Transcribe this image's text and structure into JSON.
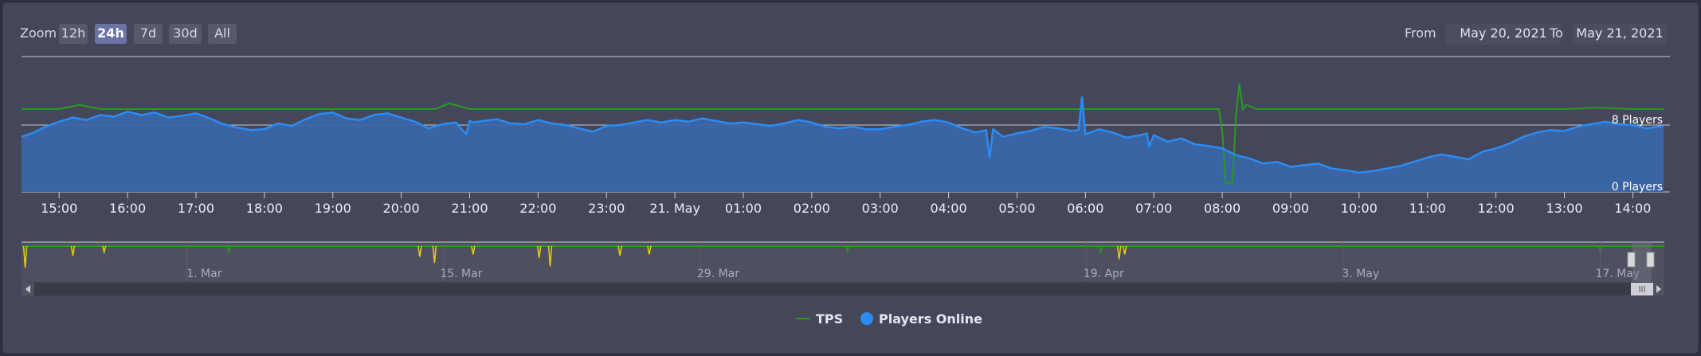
{
  "zoom": {
    "label": "Zoom",
    "buttons": [
      "12h",
      "24h",
      "7d",
      "30d",
      "All"
    ],
    "selected": "24h"
  },
  "range": {
    "from_label": "From",
    "from_value": "May 20, 2021",
    "to_label": "To",
    "to_value": "May 21, 2021"
  },
  "colors": {
    "tps": "#2a9a1f",
    "players": "#2a8cf5",
    "players_fill": "#3a66a8",
    "warn": "#e6cd16"
  },
  "chart_data": {
    "type": "area",
    "title": "",
    "x_ticks": [
      "15:00",
      "16:00",
      "17:00",
      "18:00",
      "19:00",
      "20:00",
      "21:00",
      "22:00",
      "23:00",
      "21. May",
      "01:00",
      "02:00",
      "03:00",
      "04:00",
      "05:00",
      "06:00",
      "07:00",
      "08:00",
      "09:00",
      "10:00",
      "11:00",
      "12:00",
      "13:00",
      "14:00"
    ],
    "xlim_hours": [
      14.45,
      38.45
    ],
    "y_axis": {
      "min": 0,
      "max": 8,
      "labels": [
        "0 Players",
        "8 Players"
      ]
    },
    "series": [
      {
        "name": "TPS",
        "type": "line",
        "x": [
          14.45,
          15.0,
          15.3,
          15.6,
          16.0,
          16.5,
          17.0,
          17.5,
          18.0,
          18.5,
          19.0,
          19.5,
          20.0,
          20.5,
          20.7,
          21.0,
          21.5,
          22.0,
          22.5,
          23.0,
          23.5,
          24.0,
          24.5,
          25.0,
          25.5,
          26.0,
          26.5,
          27.0,
          27.5,
          28.0,
          28.5,
          29.0,
          29.5,
          30.0,
          30.5,
          31.0,
          31.5,
          31.95,
          32.0,
          32.05,
          32.15,
          32.2,
          32.25,
          32.3,
          32.35,
          32.5,
          33.0,
          33.5,
          34.0,
          34.5,
          35.0,
          35.5,
          36.0,
          36.5,
          37.0,
          37.5,
          38.0,
          38.45
        ],
        "values": [
          20,
          20,
          20.3,
          20,
          20,
          20,
          20,
          20,
          20,
          20,
          20,
          20,
          20,
          20,
          20.4,
          20,
          20,
          20,
          20,
          20,
          20,
          20,
          20,
          20,
          20,
          20,
          20,
          20,
          20,
          20,
          20,
          20,
          20,
          20,
          20,
          20,
          20,
          20,
          18.5,
          14.8,
          14.9,
          19.5,
          21.8,
          20,
          20.3,
          20,
          20,
          20,
          20,
          20,
          20,
          20,
          20,
          20,
          20,
          20.1,
          20,
          20
        ]
      },
      {
        "name": "Players Online",
        "type": "area",
        "x": [
          14.45,
          14.6,
          14.8,
          15.0,
          15.2,
          15.4,
          15.6,
          15.8,
          16.0,
          16.2,
          16.4,
          16.6,
          16.8,
          17.0,
          17.2,
          17.4,
          17.6,
          17.8,
          18.0,
          18.2,
          18.4,
          18.6,
          18.8,
          19.0,
          19.2,
          19.4,
          19.6,
          19.8,
          20.0,
          20.2,
          20.4,
          20.6,
          20.8,
          20.95,
          21.0,
          21.05,
          21.2,
          21.4,
          21.6,
          21.8,
          22.0,
          22.2,
          22.4,
          22.6,
          22.8,
          23.0,
          23.2,
          23.4,
          23.6,
          23.8,
          24.0,
          24.2,
          24.4,
          24.6,
          24.8,
          25.0,
          25.2,
          25.4,
          25.6,
          25.8,
          26.0,
          26.2,
          26.4,
          26.6,
          26.8,
          27.0,
          27.2,
          27.4,
          27.6,
          27.8,
          28.0,
          28.2,
          28.4,
          28.55,
          28.6,
          28.65,
          28.8,
          29.0,
          29.2,
          29.4,
          29.6,
          29.8,
          29.9,
          29.95,
          30.0,
          30.2,
          30.4,
          30.6,
          30.8,
          30.9,
          30.93,
          31.0,
          31.2,
          31.4,
          31.6,
          31.8,
          32.0,
          32.2,
          32.4,
          32.6,
          32.8,
          33.0,
          33.2,
          33.4,
          33.6,
          33.8,
          34.0,
          34.2,
          34.4,
          34.6,
          34.8,
          35.0,
          35.2,
          35.4,
          35.6,
          35.8,
          36.0,
          36.2,
          36.4,
          36.6,
          36.8,
          37.0,
          37.2,
          37.4,
          37.6,
          37.8,
          38.0,
          38.2,
          38.45
        ],
        "values": [
          6.6,
          7.0,
          7.8,
          8.4,
          8.9,
          8.6,
          9.2,
          9.0,
          9.6,
          9.2,
          9.5,
          8.9,
          9.1,
          9.4,
          8.8,
          8.1,
          7.7,
          7.4,
          7.5,
          8.2,
          7.9,
          8.7,
          9.3,
          9.5,
          8.8,
          8.6,
          9.2,
          9.4,
          8.9,
          8.4,
          7.6,
          8.1,
          8.3,
          6.9,
          8.5,
          8.3,
          8.5,
          8.7,
          8.2,
          8.1,
          8.6,
          8.2,
          8.0,
          7.6,
          7.2,
          7.9,
          8.0,
          8.3,
          8.6,
          8.3,
          8.6,
          8.4,
          8.8,
          8.5,
          8.2,
          8.3,
          8.1,
          7.9,
          8.2,
          8.6,
          8.3,
          7.8,
          7.6,
          7.8,
          7.5,
          7.5,
          7.8,
          8.0,
          8.4,
          8.6,
          8.3,
          7.6,
          7.1,
          7.4,
          4.1,
          7.5,
          6.6,
          7.0,
          7.3,
          7.8,
          7.6,
          7.3,
          7.4,
          11.3,
          6.9,
          7.5,
          7.1,
          6.5,
          6.8,
          7.0,
          5.4,
          6.8,
          6.0,
          6.4,
          5.7,
          5.5,
          5.2,
          4.4,
          4.0,
          3.4,
          3.6,
          3.0,
          3.2,
          3.4,
          2.8,
          2.6,
          2.3,
          2.5,
          2.8,
          3.1,
          3.6,
          4.1,
          4.5,
          4.2,
          3.9,
          4.8,
          5.2,
          5.8,
          6.6,
          7.1,
          7.4,
          7.3,
          7.8,
          8.1,
          8.4,
          8.1,
          8.0,
          7.6,
          7.9
        ]
      }
    ],
    "navigator": {
      "ticks": [
        "1. Mar",
        "15. Mar",
        "29. Mar",
        "19. Apr",
        "3. May",
        "17. May"
      ],
      "tick_days": [
        0,
        14,
        28,
        49,
        63,
        77
      ],
      "range_days": [
        -9,
        80.5
      ],
      "selected_days": [
        79.4,
        80.5
      ],
      "dips": [
        {
          "day": -8.8,
          "depth": 0.9,
          "color": "warn"
        },
        {
          "day": -6.2,
          "depth": 0.4,
          "color": "warn"
        },
        {
          "day": -4.5,
          "depth": 0.25,
          "color": "warn"
        },
        {
          "day": 2.3,
          "depth": 0.3,
          "color": "tps"
        },
        {
          "day": 12.7,
          "depth": 0.45,
          "color": "warn"
        },
        {
          "day": 13.5,
          "depth": 0.7,
          "color": "warn"
        },
        {
          "day": 15.6,
          "depth": 0.35,
          "color": "warn"
        },
        {
          "day": 19.2,
          "depth": 0.5,
          "color": "warn"
        },
        {
          "day": 19.8,
          "depth": 0.85,
          "color": "warn"
        },
        {
          "day": 23.6,
          "depth": 0.4,
          "color": "warn"
        },
        {
          "day": 25.2,
          "depth": 0.35,
          "color": "warn"
        },
        {
          "day": 36.0,
          "depth": 0.2,
          "color": "tps"
        },
        {
          "day": 49.8,
          "depth": 0.3,
          "color": "tps"
        },
        {
          "day": 50.8,
          "depth": 0.55,
          "color": "warn"
        },
        {
          "day": 51.1,
          "depth": 0.35,
          "color": "warn"
        },
        {
          "day": 77.0,
          "depth": 0.2,
          "color": "tps"
        }
      ]
    }
  },
  "legend": {
    "tps": "TPS",
    "players": "Players Online"
  }
}
